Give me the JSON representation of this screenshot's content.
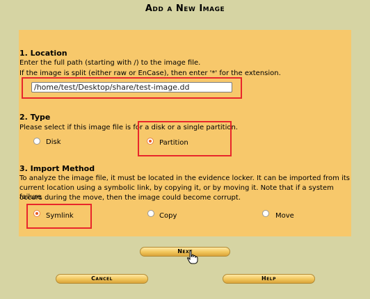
{
  "page": {
    "title": "Add a New Image"
  },
  "location": {
    "heading": "1. Location",
    "line1": "Enter the full path (starting with /) to the image file.",
    "line2": "If the image is split (either raw or EnCase), then enter '*' for the extension.",
    "path_value": "/home/test/Desktop/share/test-image.dd"
  },
  "type": {
    "heading": "2. Type",
    "desc": "Please select if this image file is for a disk or a single partition.",
    "options": [
      {
        "label": "Disk",
        "selected": false
      },
      {
        "label": "Partition",
        "selected": true
      }
    ]
  },
  "import": {
    "heading": "3. Import Method",
    "line1": "To analyze the image file, it must be located in the evidence locker. It can be imported from its",
    "line2": "current location using a symbolic link, by copying it, or by moving it. Note that if a system failure",
    "line3": "occurs during the move, then the image could become corrupt.",
    "options": [
      {
        "label": "Symlink",
        "selected": true
      },
      {
        "label": "Copy",
        "selected": false
      },
      {
        "label": "Move",
        "selected": false
      }
    ]
  },
  "buttons": {
    "next": "Next",
    "cancel": "Cancel",
    "help": "Help"
  },
  "colors": {
    "background": "#d6d4a3",
    "panel": "#f7c86b",
    "highlight": "#e8262b"
  }
}
